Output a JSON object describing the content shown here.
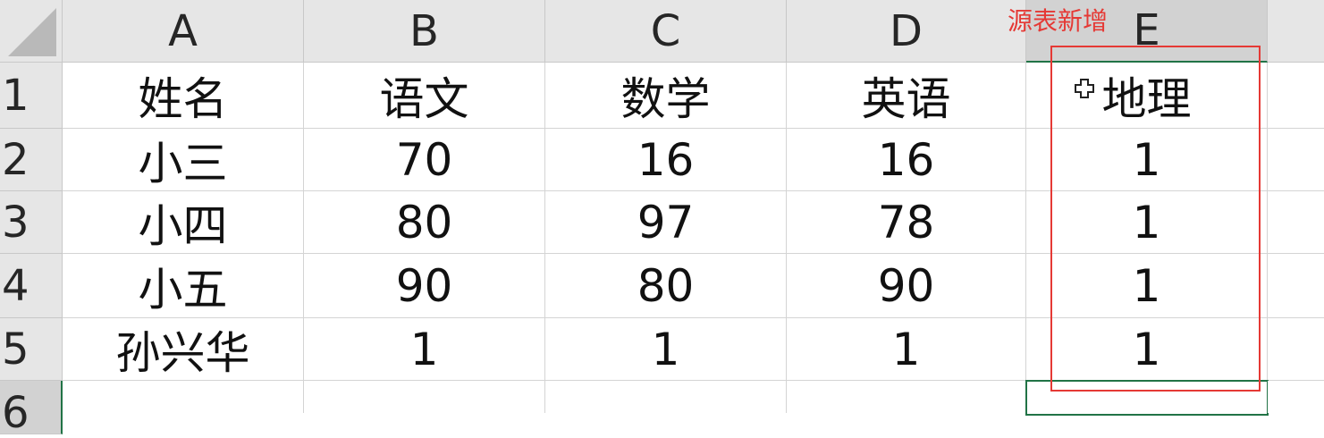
{
  "sheet": {
    "columns": [
      "A",
      "B",
      "C",
      "D",
      "E"
    ],
    "row_numbers": [
      "1",
      "2",
      "3",
      "4",
      "5",
      "6"
    ],
    "rows": [
      [
        "姓名",
        "语文",
        "数学",
        "英语",
        "地理"
      ],
      [
        "小三",
        "70",
        "16",
        "16",
        "1"
      ],
      [
        "小四",
        "80",
        "97",
        "78",
        "1"
      ],
      [
        "小五",
        "90",
        "80",
        "90",
        "1"
      ],
      [
        "孙兴华",
        "1",
        "1",
        "1",
        "1"
      ],
      [
        "",
        "",
        "",
        "",
        ""
      ]
    ],
    "selected_column": "E",
    "active_cell": "E6"
  },
  "annotation": {
    "text": "源表新增",
    "color": "#e53935"
  },
  "icons": {
    "cell_cursor": "move-cross-icon"
  },
  "colors": {
    "selection": "#217346",
    "header_bg": "#e6e6e6"
  }
}
